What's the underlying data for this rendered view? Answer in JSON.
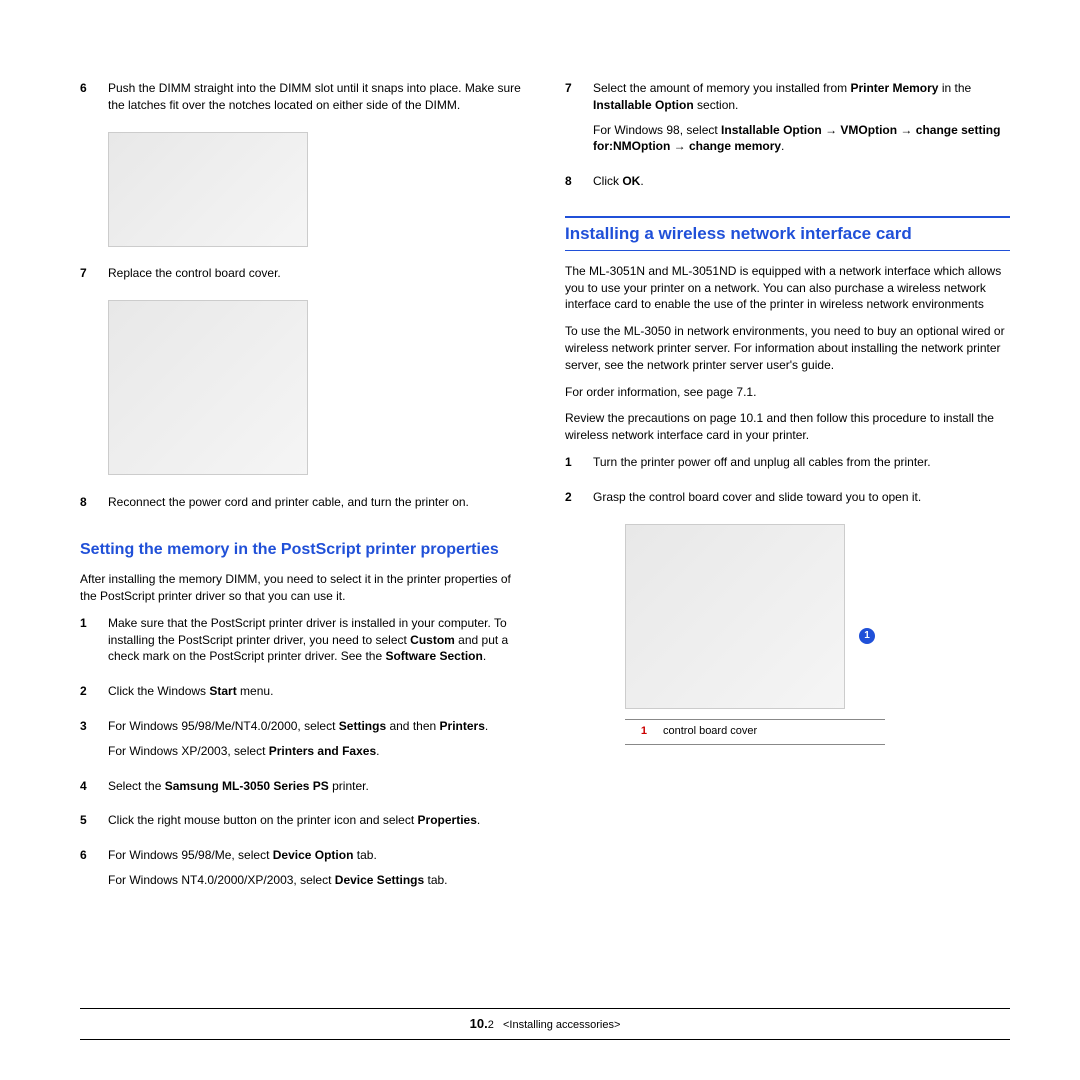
{
  "left": {
    "step6": {
      "num": "6",
      "text": "Push the DIMM straight into the DIMM slot until it snaps into place. Make sure the latches fit over the notches located on either side of the DIMM."
    },
    "step7": {
      "num": "7",
      "text": "Replace the control board cover."
    },
    "step8": {
      "num": "8",
      "text": "Reconnect the power cord and printer cable, and turn the printer on."
    },
    "h3": "Setting the memory in the PostScript printer properties",
    "intro": "After installing the memory DIMM, you need to select it in the printer properties of the PostScript printer driver so that you can use it.",
    "p1": {
      "num": "1",
      "a": "Make sure that the PostScript printer driver is installed in your computer. To installing the PostScript printer driver, you need to select ",
      "b": "Custom",
      "c": " and put a check mark on the PostScript printer driver. See the ",
      "d": "Software Section",
      "e": "."
    },
    "p2": {
      "num": "2",
      "a": "Click the Windows ",
      "b": "Start",
      "c": " menu."
    },
    "p3": {
      "num": "3",
      "a": "For Windows 95/98/Me/NT4.0/2000, select ",
      "b": "Settings",
      "c": " and then ",
      "d": "Printers",
      "e": ".",
      "f": "For Windows XP/2003, select ",
      "g": "Printers and Faxes",
      "h": "."
    },
    "p4": {
      "num": "4",
      "a": "Select the ",
      "b": "Samsung ML-3050 Series PS",
      "c": " printer."
    },
    "p5": {
      "num": "5",
      "a": "Click the right mouse button on the printer icon and select ",
      "b": "Properties",
      "c": "."
    },
    "p6": {
      "num": "6",
      "a": "For Windows 95/98/Me, select ",
      "b": "Device Option",
      "c": " tab.",
      "d": "For Windows NT4.0/2000/XP/2003, select ",
      "e": "Device Settings",
      "f": " tab."
    }
  },
  "right": {
    "p7": {
      "num": "7",
      "a": "Select the amount of memory you installed from ",
      "b": "Printer Memory",
      "c": " in the ",
      "d": "Installable Option",
      "e": " section.",
      "f": "For Windows 98, select ",
      "g": "Installable Option",
      "h": "VMOption",
      "i": "change setting for:NMOption",
      "j": "change memory",
      "k": "."
    },
    "p8": {
      "num": "8",
      "a": "Click ",
      "b": "OK",
      "c": "."
    },
    "h2": "Installing a wireless network interface card",
    "para1": "The ML-3051N and ML-3051ND is equipped with a network interface which allows you to use your printer on a network. You can also purchase a wireless network interface card to enable the use of the printer in wireless network environments",
    "para2": "To use the ML-3050 in network environments, you need to buy an optional wired or wireless network printer server. For information about installing the network printer server, see the network printer server user's guide.",
    "para3": "For order information, see page 7.1.",
    "para4": "Review the precautions on page 10.1 and then follow this procedure to install the wireless network interface card in your printer.",
    "s1": {
      "num": "1",
      "text": "Turn the printer power off and unplug all cables from the printer."
    },
    "s2": {
      "num": "2",
      "text": "Grasp the control board cover and slide toward you to open it."
    },
    "callout_num": "1",
    "callout_bubble": "1",
    "callout_label": "control board cover"
  },
  "footer": {
    "chap": "10.",
    "page": "2",
    "title": "<Installing accessories>"
  },
  "arrow": "→"
}
